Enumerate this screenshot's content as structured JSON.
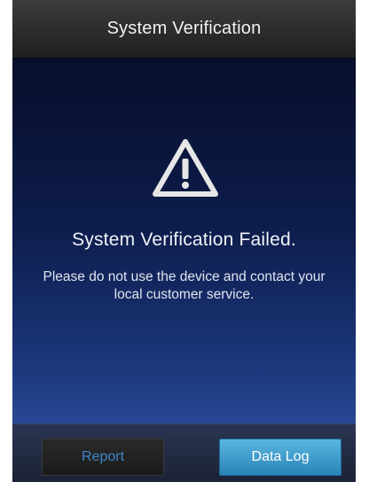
{
  "header": {
    "title": "System Verification"
  },
  "alert": {
    "icon": "warning-triangle-icon",
    "heading": "System Verification Failed.",
    "message": "Please do not use the device and contact your local customer service."
  },
  "actions": {
    "report_label": "Report",
    "data_log_label": "Data Log"
  },
  "colors": {
    "title_bar": "#2c2c2c",
    "content_top": "#070f2b",
    "content_bottom": "#274893",
    "report_text": "#3f86c8",
    "data_log_button": "#3a9bd0"
  }
}
